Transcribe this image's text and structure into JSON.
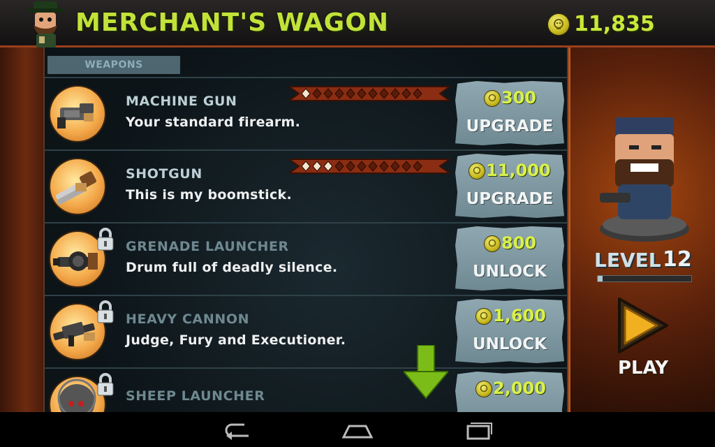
{
  "header": {
    "title": "MERCHANT'S WAGON",
    "coins": "11,835"
  },
  "tabs": [
    "WEAPONS"
  ],
  "weapons": [
    {
      "name": "MACHINE GUN",
      "desc": "Your standard firearm.",
      "price": "300",
      "action": "UPGRADE",
      "locked": false,
      "stars_filled": 1,
      "stars_total": 11
    },
    {
      "name": "SHOTGUN",
      "desc": "This is my boomstick.",
      "price": "11,000",
      "action": "UPGRADE",
      "locked": false,
      "stars_filled": 3,
      "stars_total": 11
    },
    {
      "name": "GRENADE LAUNCHER",
      "desc": "Drum full of deadly silence.",
      "price": "800",
      "action": "UNLOCK",
      "locked": true
    },
    {
      "name": "HEAVY CANNON",
      "desc": "Judge, Fury and Executioner.",
      "price": "1,600",
      "action": "UNLOCK",
      "locked": true
    },
    {
      "name": "SHEEP LAUNCHER",
      "desc": "",
      "price": "2,000",
      "action": "",
      "locked": true
    }
  ],
  "player": {
    "level_label": "LEVEL",
    "level": "12",
    "xp_progress": 0.05
  },
  "play_label": "PLAY",
  "colors": {
    "title_green": "#c2e23a",
    "coin_gold": "#d8cf2a",
    "price_card": "#7f98a2",
    "ribbon_red": "#8a2d12"
  }
}
